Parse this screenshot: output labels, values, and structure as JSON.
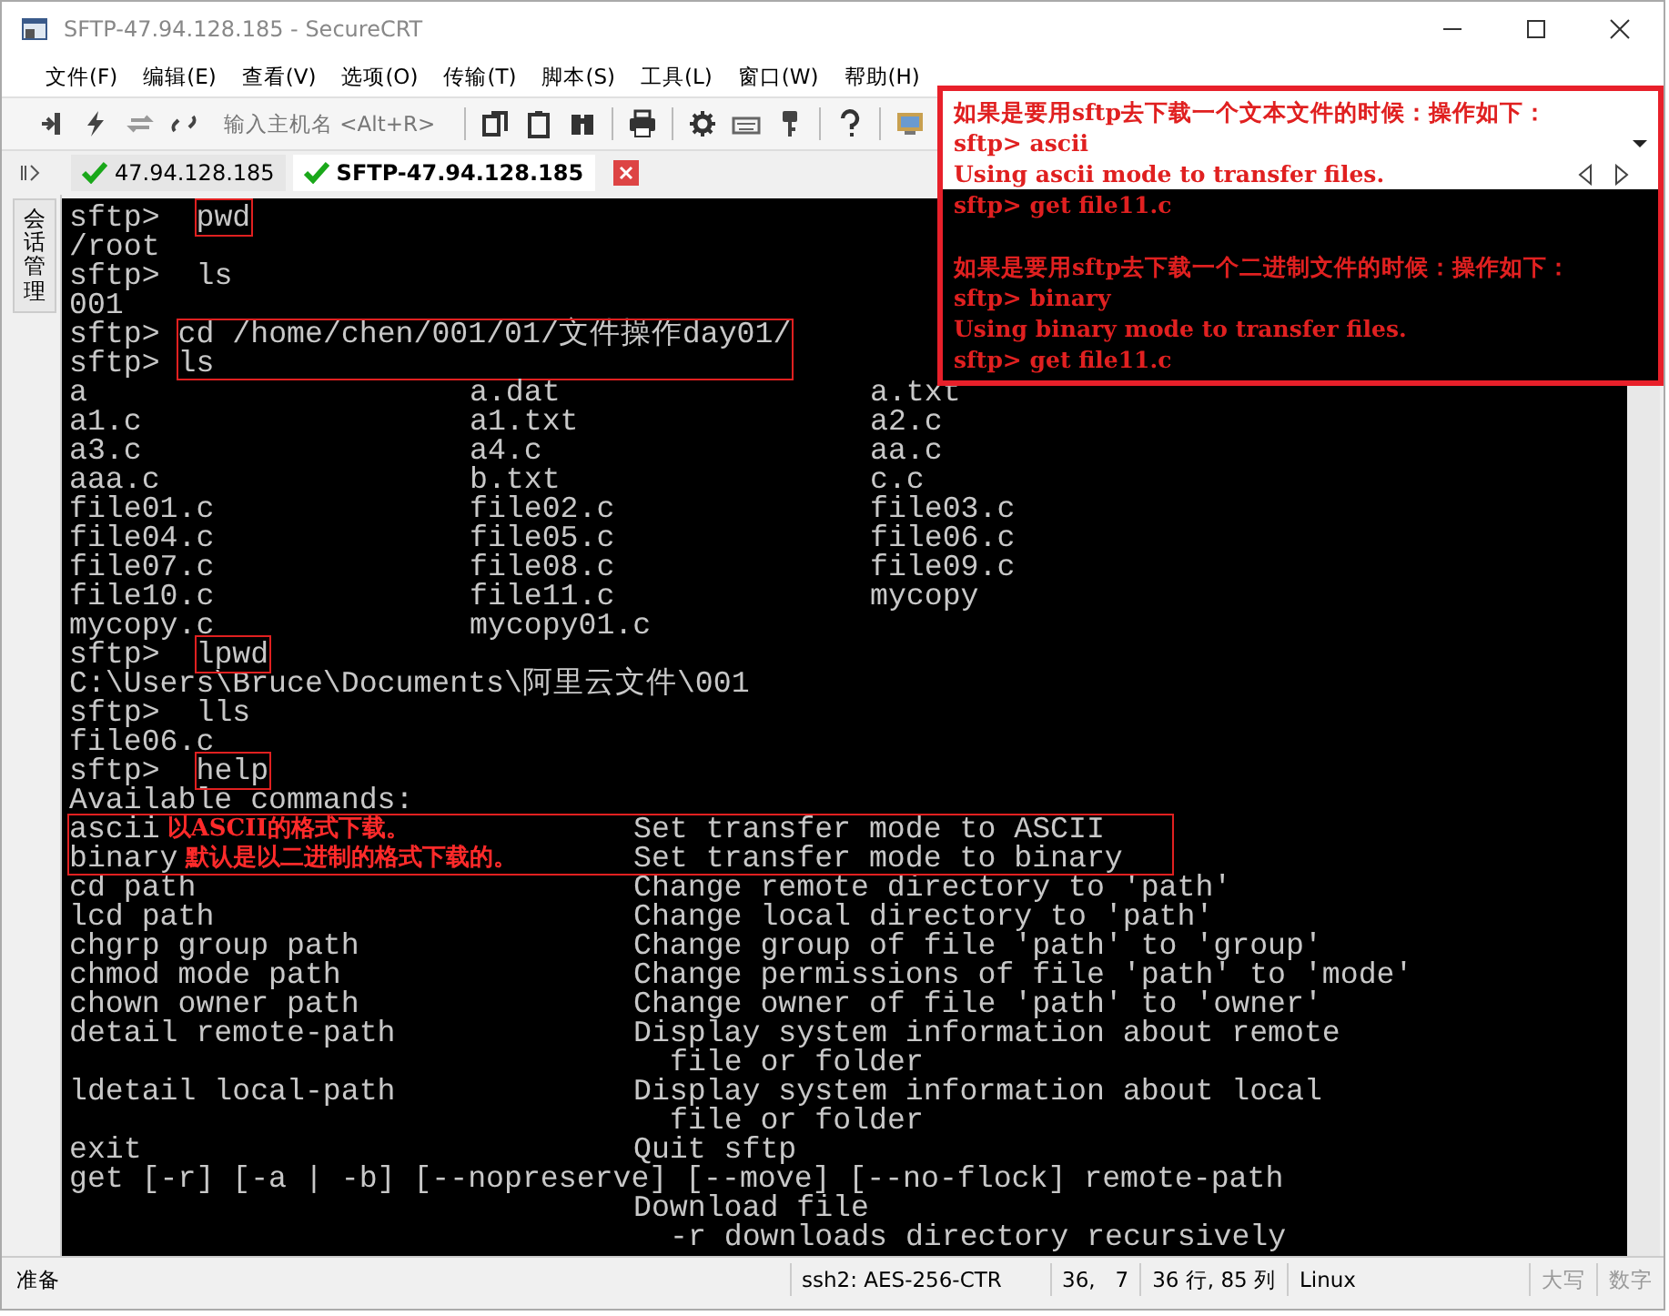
{
  "window": {
    "title": "SFTP-47.94.128.185 - SecureCRT"
  },
  "menu": [
    "文件(F)",
    "编辑(E)",
    "查看(V)",
    "选项(O)",
    "传输(T)",
    "脚本(S)",
    "工具(L)",
    "窗口(W)",
    "帮助(H)"
  ],
  "toolbar": {
    "host_field": "输入主机名 <Alt+R>"
  },
  "sidebar": {
    "label": "会话管理"
  },
  "tabs": [
    {
      "label": "47.94.128.185",
      "selected": false,
      "connected": true
    },
    {
      "label": "SFTP-47.94.128.185",
      "selected": true,
      "connected": true
    }
  ],
  "terminal": {
    "lines": [
      {
        "kind": "prompt",
        "prompt": "sftp>",
        "command": "pwd",
        "highlighted": true
      },
      {
        "kind": "text",
        "text": "/root"
      },
      {
        "kind": "prompt",
        "prompt": "sftp>",
        "command": "ls",
        "highlighted": false
      },
      {
        "kind": "text",
        "text": "001"
      },
      {
        "kind": "prompt_block",
        "prompts": [
          "sftp>",
          "sftp>"
        ],
        "commands": [
          "cd /home/chen/001/01/文件操作day01/",
          "ls"
        ],
        "highlighted": true
      },
      {
        "kind": "columns",
        "cells": [
          "a",
          "a.dat",
          "a.txt"
        ]
      },
      {
        "kind": "columns",
        "cells": [
          "a1.c",
          "a1.txt",
          "a2.c"
        ]
      },
      {
        "kind": "columns",
        "cells": [
          "a3.c",
          "a4.c",
          "aa.c"
        ]
      },
      {
        "kind": "columns",
        "cells": [
          "aaa.c",
          "b.txt",
          "c.c"
        ]
      },
      {
        "kind": "columns",
        "cells": [
          "file01.c",
          "file02.c",
          "file03.c"
        ]
      },
      {
        "kind": "columns",
        "cells": [
          "file04.c",
          "file05.c",
          "file06.c"
        ]
      },
      {
        "kind": "columns",
        "cells": [
          "file07.c",
          "file08.c",
          "file09.c"
        ]
      },
      {
        "kind": "columns",
        "cells": [
          "file10.c",
          "file11.c",
          "mycopy"
        ]
      },
      {
        "kind": "columns",
        "cells": [
          "mycopy.c",
          "mycopy01.c"
        ]
      },
      {
        "kind": "prompt",
        "prompt": "sftp>",
        "command": "lpwd",
        "highlighted": true
      },
      {
        "kind": "text",
        "text": "C:\\Users\\Bruce\\Documents\\阿里云文件\\001"
      },
      {
        "kind": "prompt",
        "prompt": "sftp>",
        "command": "lls",
        "highlighted": false
      },
      {
        "kind": "text",
        "text": "file06.c"
      },
      {
        "kind": "prompt",
        "prompt": "sftp>",
        "command": "help",
        "highlighted": true
      },
      {
        "kind": "text",
        "text": "Available commands:"
      },
      {
        "kind": "help_block",
        "highlighted": true,
        "rows": [
          {
            "command": "ascii",
            "note": "以ASCII的格式下载。",
            "description": "Set transfer mode to ASCII"
          },
          {
            "command": "binary",
            "note": "默认是以二进制的格式下载的。",
            "description": "Set transfer mode to binary"
          }
        ]
      },
      {
        "kind": "help",
        "command": "cd path",
        "description": "Change remote directory to 'path'"
      },
      {
        "kind": "help",
        "command": "lcd path",
        "description": "Change local directory to 'path'"
      },
      {
        "kind": "help",
        "command": "chgrp group path",
        "description": "Change group of file 'path' to 'group'"
      },
      {
        "kind": "help",
        "command": "chmod mode path",
        "description": "Change permissions of file 'path' to 'mode'"
      },
      {
        "kind": "help",
        "command": "chown owner path",
        "description": "Change owner of file 'path' to 'owner'"
      },
      {
        "kind": "help",
        "command": "detail remote-path",
        "description": "Display system information about remote"
      },
      {
        "kind": "help_cont",
        "description": "file or folder"
      },
      {
        "kind": "help",
        "command": "ldetail local-path",
        "description": "Display system information about local"
      },
      {
        "kind": "help_cont",
        "description": "file or folder"
      },
      {
        "kind": "help",
        "command": "exit",
        "description": "Quit sftp"
      },
      {
        "kind": "text",
        "text": "get [-r] [-a | -b] [--nopreserve] [--move] [--no-flock] remote-path"
      },
      {
        "kind": "help_desc",
        "description": "Download file"
      },
      {
        "kind": "help_cont",
        "description": "-r downloads directory recursively"
      }
    ]
  },
  "annotation": {
    "light_lines": [
      "如果是要用sftp去下载一个文本文件的时候：操作如下：",
      "sftp> ascii",
      "Using ascii mode to transfer files."
    ],
    "dark_paragraphs": [
      [
        "sftp> get file11.c"
      ],
      [
        "如果是要用sftp去下载一个二进制文件的时候：操作如下：",
        "sftp> binary",
        "Using binary mode to transfer files.",
        "sftp> get file11.c"
      ]
    ]
  },
  "status_bar": {
    "message": "准备",
    "cipher": "ssh2: AES-256-CTR",
    "cursor": "36,   7",
    "size": "36 行, 85 列",
    "os": "Linux",
    "caps": "大写",
    "num": "数字"
  }
}
